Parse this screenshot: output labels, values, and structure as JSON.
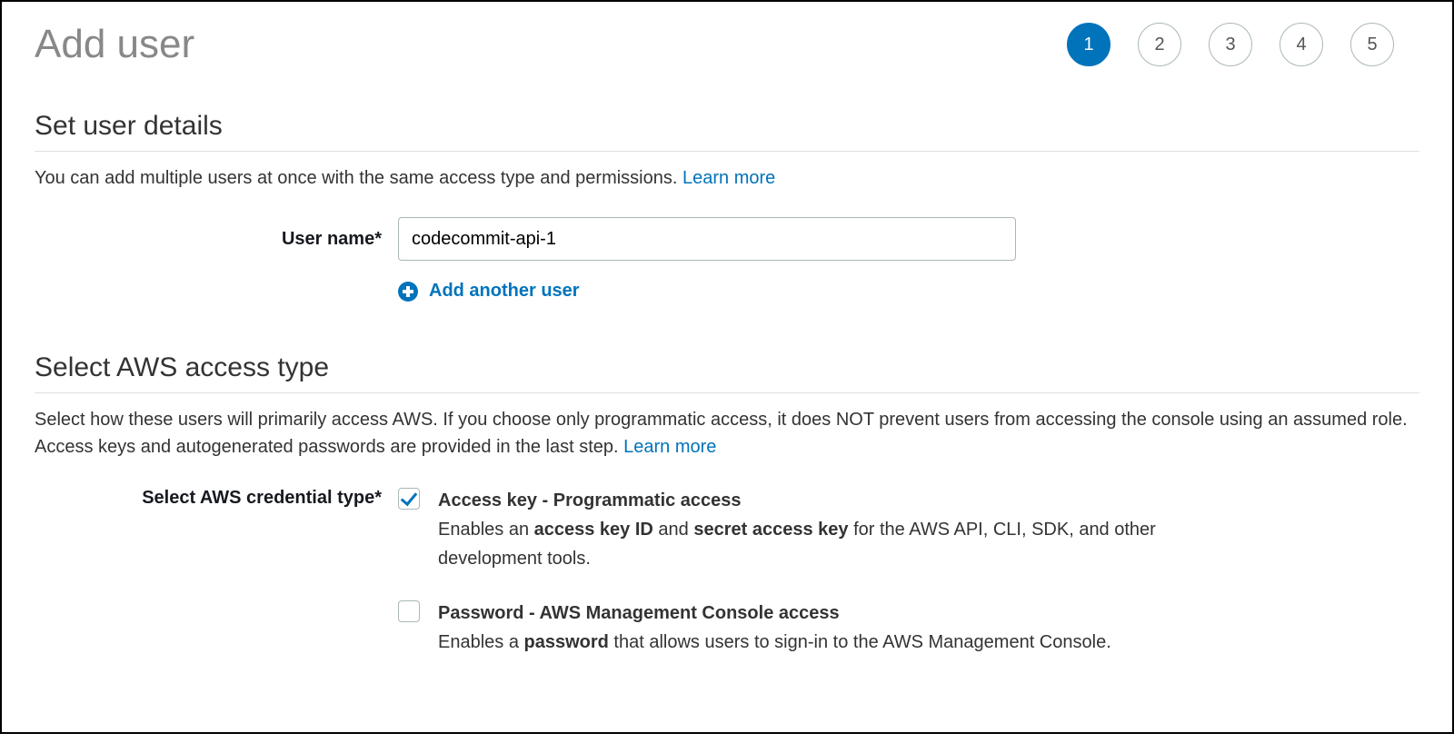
{
  "header": {
    "title": "Add user",
    "steps": [
      "1",
      "2",
      "3",
      "4",
      "5"
    ],
    "active_step": 1
  },
  "section_details": {
    "heading": "Set user details",
    "desc_prefix": "You can add multiple users at once with the same access type and permissions. ",
    "learn_more": "Learn more",
    "username_label": "User name*",
    "username_value": "codecommit-api-1",
    "add_another": "Add another user"
  },
  "section_access": {
    "heading": "Select AWS access type",
    "desc_prefix": "Select how these users will primarily access AWS. If you choose only programmatic access, it does NOT prevent users from accessing the console using an assumed role. Access keys and autogenerated passwords are provided in the last step. ",
    "learn_more": "Learn more",
    "cred_label": "Select AWS credential type*",
    "option1": {
      "checked": true,
      "title": "Access key - Programmatic access",
      "desc_1": "Enables an ",
      "desc_b1": "access key ID",
      "desc_2": " and ",
      "desc_b2": "secret access key",
      "desc_3": " for the AWS API, CLI, SDK, and other development tools."
    },
    "option2": {
      "checked": false,
      "title": "Password - AWS Management Console access",
      "desc_1": "Enables a ",
      "desc_b1": "password",
      "desc_2": " that allows users to sign-in to the AWS Management Console."
    }
  }
}
